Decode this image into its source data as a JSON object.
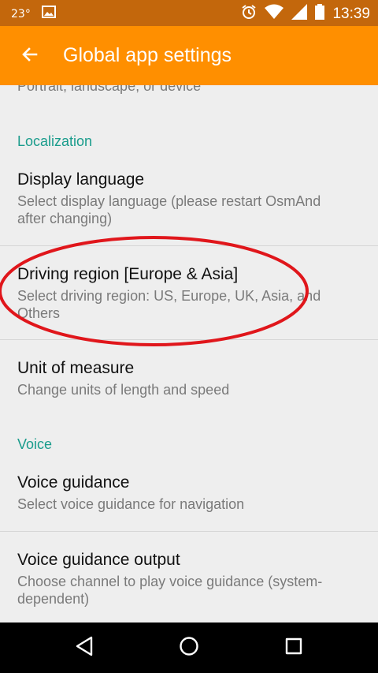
{
  "status_bar": {
    "temperature": "23°",
    "time": "13:39",
    "icons": [
      "image-icon",
      "alarm-icon",
      "wifi-icon",
      "signal-icon",
      "battery-icon"
    ]
  },
  "toolbar": {
    "title": "Global app settings",
    "back_icon": "arrow-back-icon",
    "background": "#ff8f00"
  },
  "content": {
    "previous_summary": "Portrait, landscape, or device",
    "localization_header": "Localization",
    "display_language": {
      "title": "Display language",
      "summary": "Select display language (please restart OsmAnd after changing)"
    },
    "driving_region": {
      "title": "Driving region  [Europe & Asia]",
      "summary": "Select driving region: US, Europe, UK, Asia, and Others"
    },
    "unit_of_measure": {
      "title": "Unit of measure",
      "summary": "Change units of length and speed"
    },
    "voice_header": "Voice",
    "voice_guidance": {
      "title": "Voice guidance",
      "summary": "Select voice guidance for navigation"
    },
    "voice_guidance_output": {
      "title": "Voice guidance output",
      "summary": "Choose channel to play voice guidance (system-dependent)"
    }
  },
  "annotation": {
    "color": "#e0161b"
  },
  "nav_bar": {
    "icons": [
      "back-triangle-icon",
      "home-circle-icon",
      "recents-square-icon"
    ]
  }
}
